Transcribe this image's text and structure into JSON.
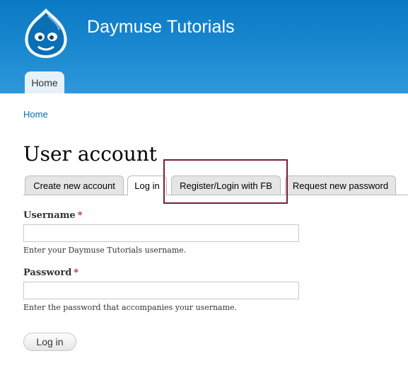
{
  "site": {
    "name": "Daymuse Tutorials",
    "logo_icon": "drupal-drop-icon"
  },
  "primary_nav": {
    "items": [
      {
        "label": "Home",
        "active": true
      }
    ]
  },
  "breadcrumb": {
    "items": [
      "Home"
    ]
  },
  "page": {
    "title": "User account"
  },
  "tabs": [
    {
      "label": "Create new account",
      "active": false
    },
    {
      "label": "Log in",
      "active": true
    },
    {
      "label": "Register/Login with FB",
      "active": false,
      "highlighted": true
    },
    {
      "label": "Request new password",
      "active": false
    }
  ],
  "form": {
    "username": {
      "label": "Username",
      "required_marker": "*",
      "value": "",
      "description": "Enter your Daymuse Tutorials username."
    },
    "password": {
      "label": "Password",
      "required_marker": "*",
      "value": "",
      "description": "Enter the password that accompanies your username."
    },
    "submit_label": "Log in"
  },
  "colors": {
    "header_blue": "#1b89d0",
    "link_blue": "#0071b3",
    "required_red": "#d02020",
    "highlight_border": "#7a1f3d"
  }
}
